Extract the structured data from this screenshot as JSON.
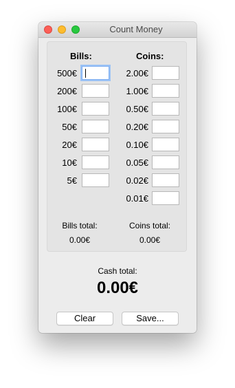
{
  "window": {
    "title": "Count Money"
  },
  "bills": {
    "header": "Bills:",
    "rows": [
      {
        "label": "500€",
        "value": ""
      },
      {
        "label": "200€",
        "value": ""
      },
      {
        "label": "100€",
        "value": ""
      },
      {
        "label": "50€",
        "value": ""
      },
      {
        "label": "20€",
        "value": ""
      },
      {
        "label": "10€",
        "value": ""
      },
      {
        "label": "5€",
        "value": ""
      }
    ],
    "total_label": "Bills total:",
    "total_value": "0.00€"
  },
  "coins": {
    "header": "Coins:",
    "rows": [
      {
        "label": "2.00€",
        "value": ""
      },
      {
        "label": "1.00€",
        "value": ""
      },
      {
        "label": "0.50€",
        "value": ""
      },
      {
        "label": "0.20€",
        "value": ""
      },
      {
        "label": "0.10€",
        "value": ""
      },
      {
        "label": "0.05€",
        "value": ""
      },
      {
        "label": "0.02€",
        "value": ""
      },
      {
        "label": "0.01€",
        "value": ""
      }
    ],
    "total_label": "Coins total:",
    "total_value": "0.00€"
  },
  "cash": {
    "label": "Cash total:",
    "value": "0.00€"
  },
  "buttons": {
    "clear": "Clear",
    "save": "Save..."
  },
  "colors": {
    "close": "#fc5f57",
    "minimize": "#fdbc2e",
    "maximize": "#28c840",
    "focus_ring": "#9cc3f5"
  }
}
